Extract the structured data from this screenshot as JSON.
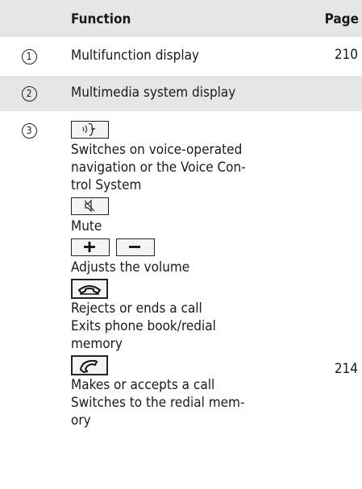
{
  "header": {
    "function": "Function",
    "page": "Page"
  },
  "rows": [
    {
      "num": "1",
      "function": "Multifunction display",
      "page": "210"
    },
    {
      "num": "2",
      "function": "Multimedia system display",
      "page": ""
    },
    {
      "num": "3",
      "page": "214",
      "items": {
        "voice_icon": "voice-control-key-icon",
        "voice_text": [
          "Switches on voice-operated",
          "navigation or the Voice Con-",
          "trol System"
        ],
        "mute_icon": "mute-key-icon",
        "mute_text": "Mute",
        "plus_icon": "volume-plus-key-icon",
        "minus_icon": "volume-minus-key-icon",
        "volume_text": "Adjusts the volume",
        "hangup_icon": "end-call-key-icon",
        "hangup_text": [
          "Rejects or ends a call",
          "Exits phone book/redial",
          "memory"
        ],
        "call_icon": "accept-call-key-icon",
        "call_text": [
          "Makes or accepts a call",
          "Switches to the redial mem-",
          "ory"
        ]
      }
    }
  ]
}
